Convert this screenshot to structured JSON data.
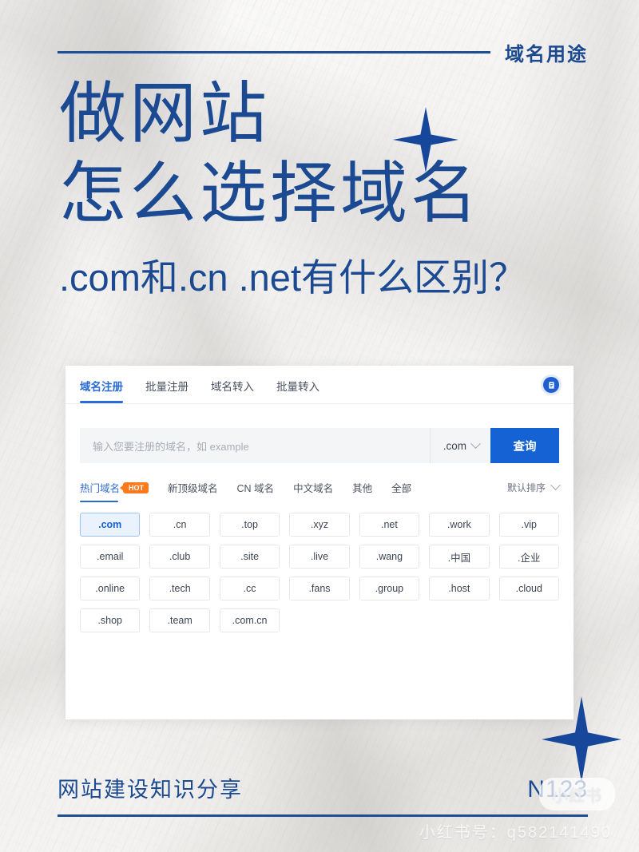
{
  "header": {
    "label": "域名用途"
  },
  "hero": {
    "line1": "做网站",
    "line2": "怎么选择域名",
    "subtitle": ".com和.cn .net有什么区别？",
    "star_icon_a": "four-point-star",
    "star_icon_b": "four-point-star"
  },
  "card": {
    "tabs": [
      {
        "label": "域名注册",
        "active": true
      },
      {
        "label": "批量注册",
        "active": false
      },
      {
        "label": "域名转入",
        "active": false
      },
      {
        "label": "批量转入",
        "active": false
      }
    ],
    "doc_badge_icon": "document-icon",
    "search": {
      "placeholder": "输入您要注册的域名，如 example",
      "value": "",
      "suffix_selected": ".com",
      "suffix_chevron_icon": "chevron-down-icon",
      "button_label": "查询"
    },
    "categories": [
      {
        "label": "热门域名",
        "active": true,
        "badge": "HOT"
      },
      {
        "label": "新顶级域名",
        "active": false,
        "badge": ""
      },
      {
        "label": "CN 域名",
        "active": false,
        "badge": ""
      },
      {
        "label": "中文域名",
        "active": false,
        "badge": ""
      },
      {
        "label": "其他",
        "active": false,
        "badge": ""
      },
      {
        "label": "全部",
        "active": false,
        "badge": ""
      }
    ],
    "sort": {
      "label": "默认排序",
      "chevron_icon": "chevron-down-icon"
    },
    "chips": [
      {
        "label": ".com",
        "selected": true
      },
      {
        "label": ".cn",
        "selected": false
      },
      {
        "label": ".top",
        "selected": false
      },
      {
        "label": ".xyz",
        "selected": false
      },
      {
        "label": ".net",
        "selected": false
      },
      {
        "label": ".work",
        "selected": false
      },
      {
        "label": ".vip",
        "selected": false
      },
      {
        "label": ".email",
        "selected": false
      },
      {
        "label": ".club",
        "selected": false
      },
      {
        "label": ".site",
        "selected": false
      },
      {
        "label": ".live",
        "selected": false
      },
      {
        "label": ".wang",
        "selected": false
      },
      {
        "label": ".中国",
        "selected": false
      },
      {
        "label": ".企业",
        "selected": false
      },
      {
        "label": ".online",
        "selected": false
      },
      {
        "label": ".tech",
        "selected": false
      },
      {
        "label": ".cc",
        "selected": false
      },
      {
        "label": ".fans",
        "selected": false
      },
      {
        "label": ".group",
        "selected": false
      },
      {
        "label": ".host",
        "selected": false
      },
      {
        "label": ".cloud",
        "selected": false
      },
      {
        "label": ".shop",
        "selected": false
      },
      {
        "label": ".team",
        "selected": false
      },
      {
        "label": ".com.cn",
        "selected": false
      }
    ]
  },
  "footer": {
    "left": "网站建设知识分享",
    "right": "N123",
    "sticker": "小红书",
    "watermark": "小红书号：q582141490"
  },
  "colors": {
    "brand_blue": "#1b4a93",
    "rule_blue": "#1f4e96",
    "ui_blue": "#1462d4",
    "tab_blue": "#2a6ad4",
    "hot_orange": "#fb7a1e",
    "chip_selected_bg": "#eaf2fe",
    "card_bg": "#ffffff",
    "input_bg": "#f4f5f7"
  }
}
